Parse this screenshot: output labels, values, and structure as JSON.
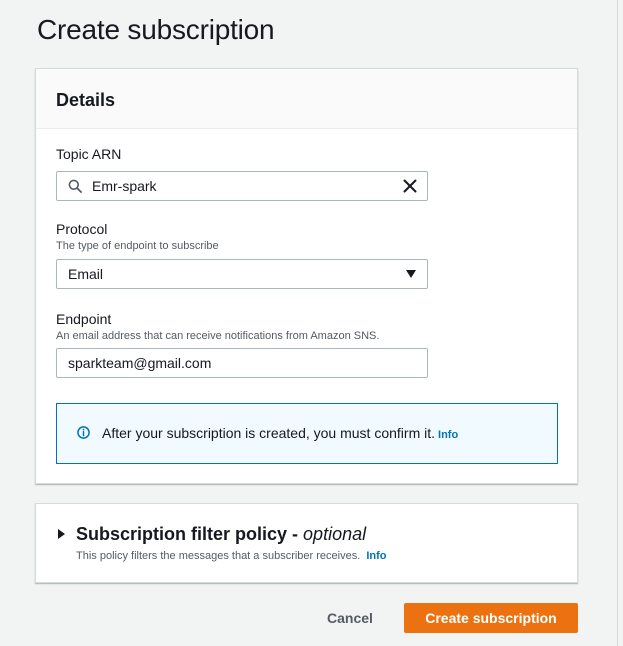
{
  "page": {
    "title": "Create subscription"
  },
  "details": {
    "heading": "Details",
    "topic": {
      "label": "Topic ARN",
      "value": "Emr-spark",
      "search_icon": "search-icon",
      "clear_icon": "close-icon"
    },
    "protocol": {
      "label": "Protocol",
      "description": "The type of endpoint to subscribe",
      "value": "Email",
      "caret_icon": "caret-down-icon"
    },
    "endpoint": {
      "label": "Endpoint",
      "description": "An email address that can receive notifications from Amazon SNS.",
      "value": "sparkteam@gmail.com"
    },
    "alert": {
      "icon": "info-icon",
      "message": "After your subscription is created, you must confirm it.",
      "link": "Info"
    }
  },
  "filter_policy": {
    "title": "Subscription filter policy -",
    "optional": "optional",
    "description": "This policy filters the messages that a subscriber receives.",
    "link": "Info",
    "expand_icon": "caret-right-icon"
  },
  "actions": {
    "cancel_label": "Cancel",
    "create_label": "Create subscription"
  },
  "colors": {
    "primary_button": "#ec7211",
    "link": "#0073bb",
    "alert_background": "#f1faff",
    "alert_border": "#0073bb",
    "page_background": "#f2f3f3"
  }
}
